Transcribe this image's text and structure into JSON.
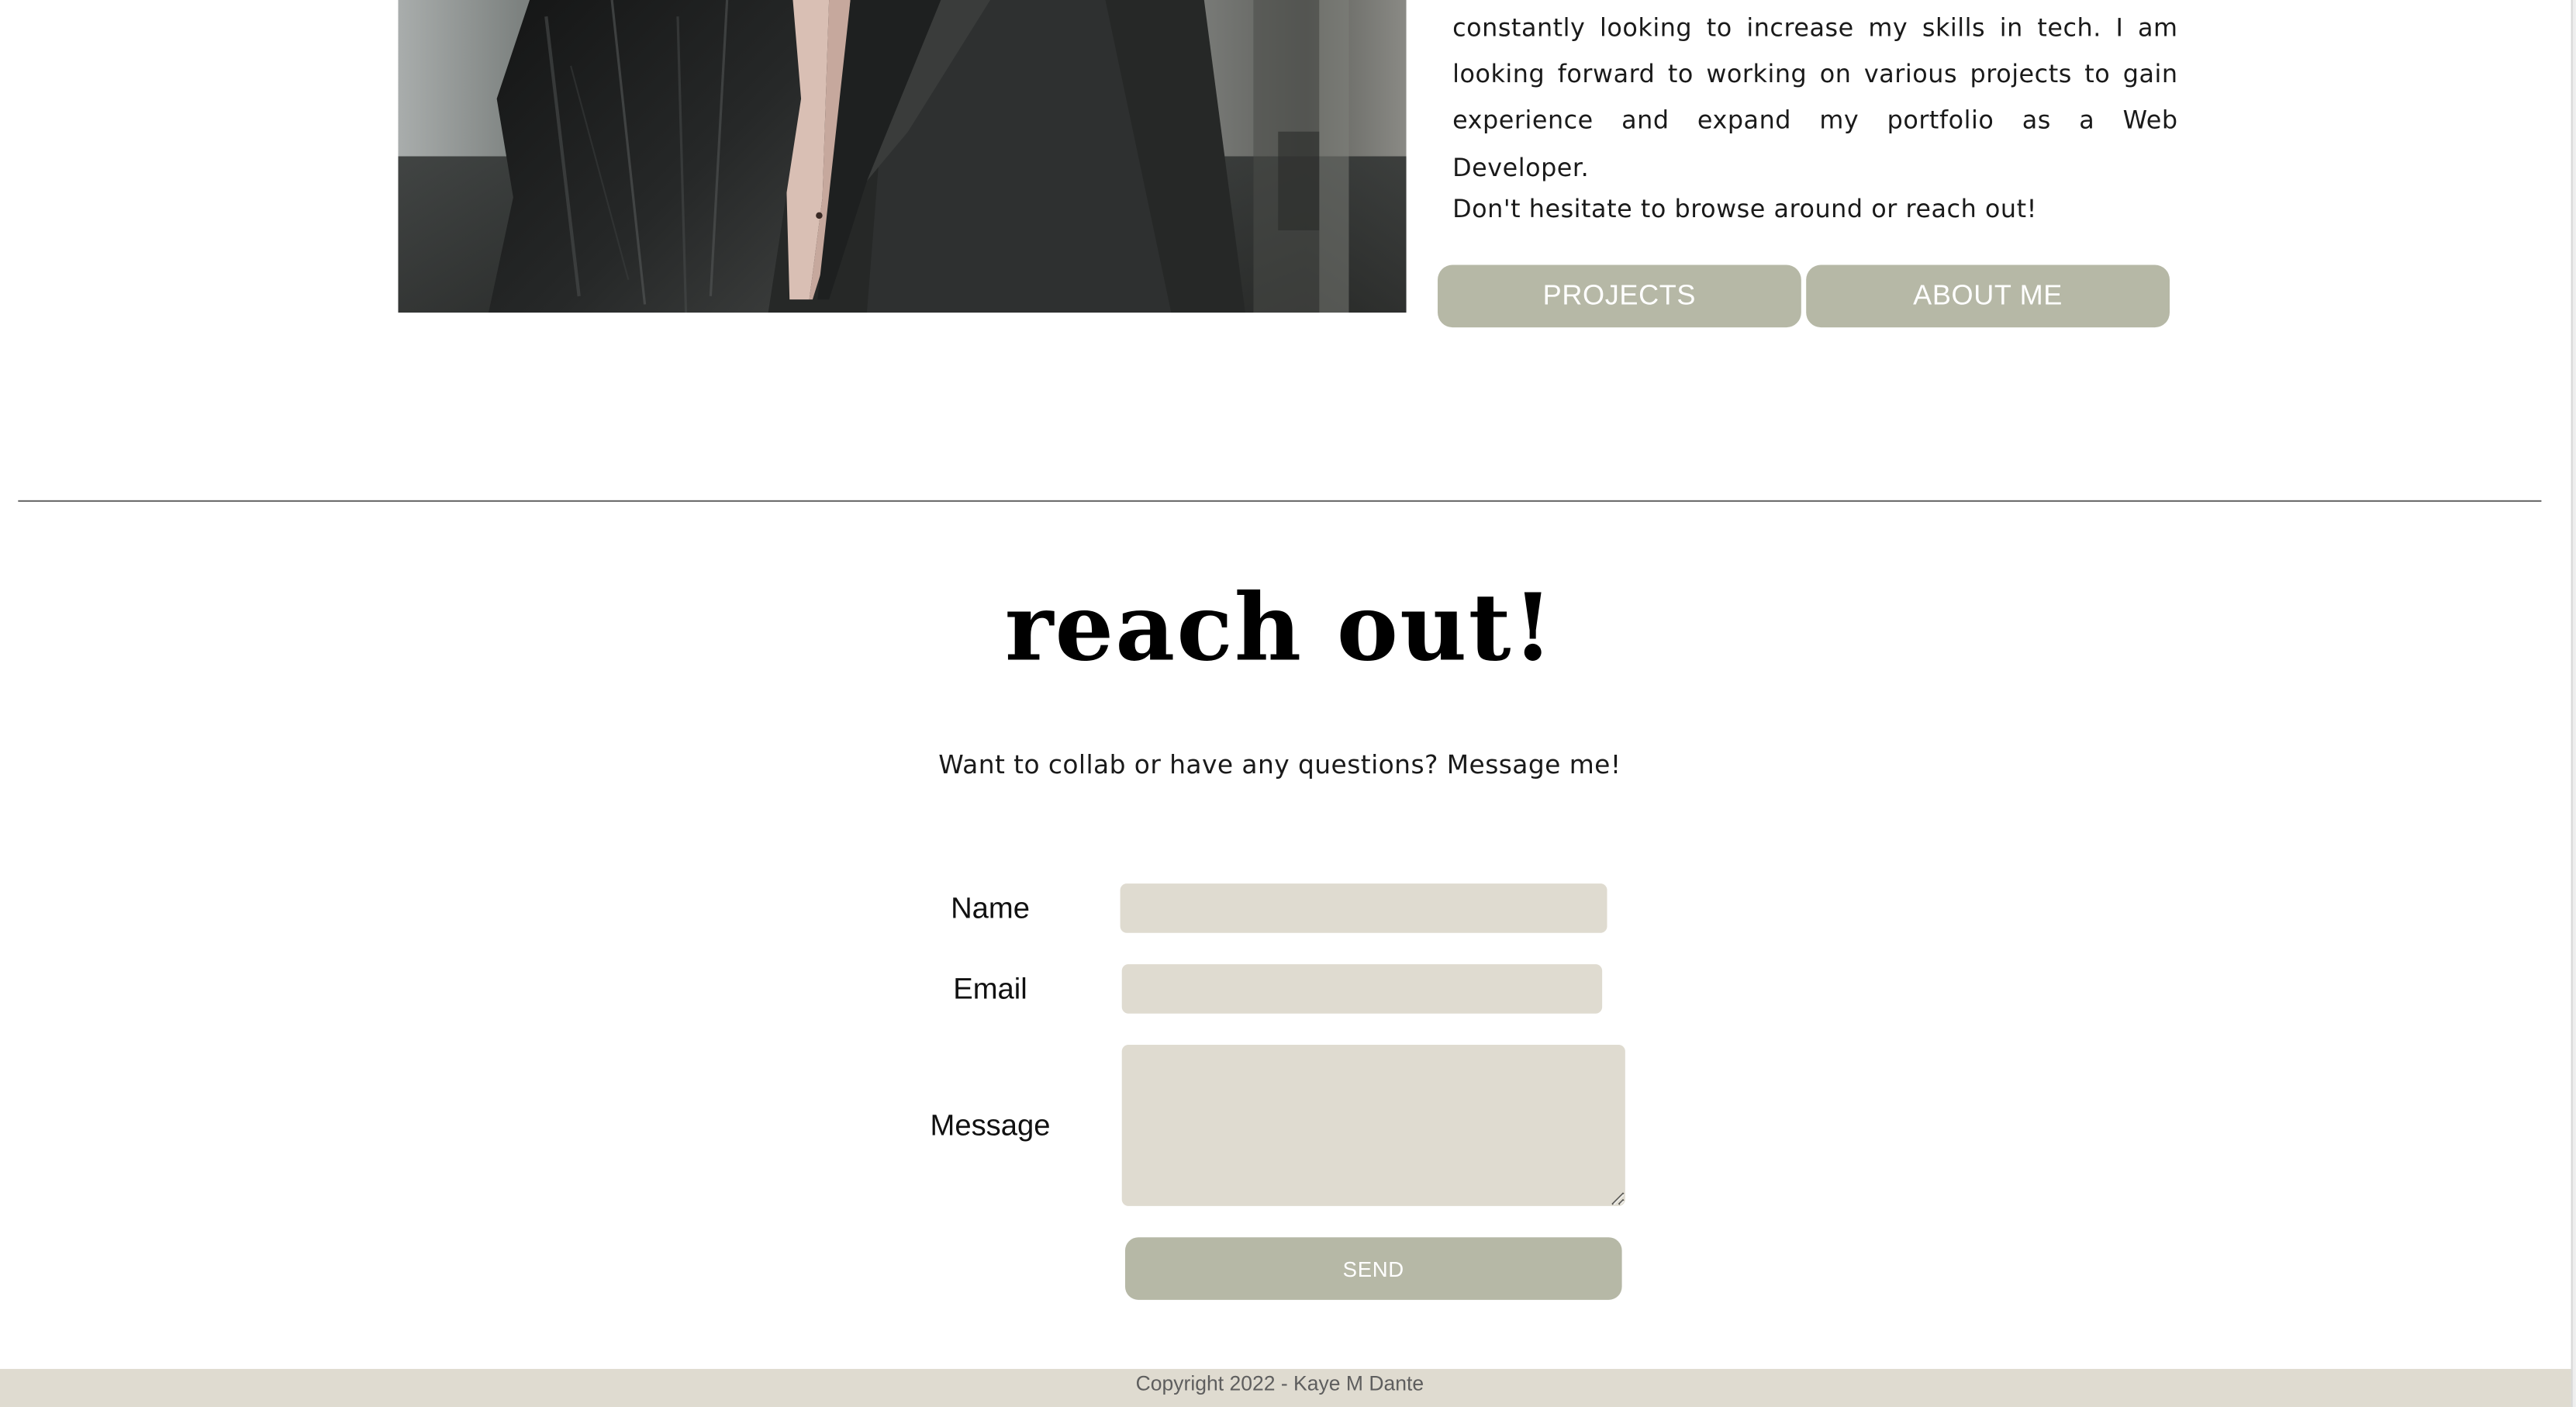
{
  "about": {
    "paragraph_1": "constantly looking to increase my skills in tech. I am looking forward to working on various projects to gain experience and expand my portfolio as a Web Developer.",
    "paragraph_2": "Don't hesitate to browse around or reach out!",
    "buttons": {
      "projects": "PROJECTS",
      "about_me": "ABOUT ME"
    }
  },
  "contact": {
    "heading": "reach out!",
    "subtext": "Want to collab or have any questions? Message me!",
    "form": {
      "name_label": "Name",
      "name_value": "",
      "email_label": "Email",
      "email_value": "",
      "message_label": "Message",
      "message_value": "",
      "send_label": "SEND"
    }
  },
  "footer": {
    "copyright": "Copyright 2022 - Kaye M Dante"
  },
  "colors": {
    "button_bg": "#b6b8a6",
    "field_bg": "#dfdbd0",
    "footer_bg": "#dfdbd0",
    "divider": "#6e6e6e"
  }
}
